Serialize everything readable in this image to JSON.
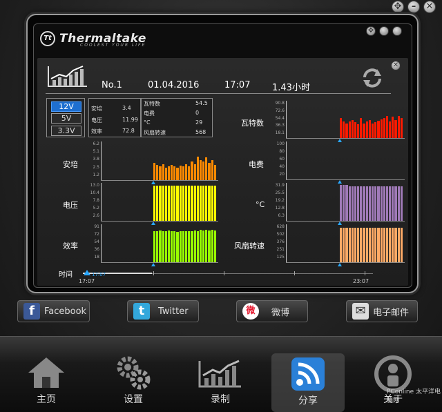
{
  "window": {
    "buttons": [
      "✥",
      "–",
      "✕"
    ]
  },
  "app": {
    "brand": "Thermaltake",
    "tagline": "COOLEST YOUR LIFE",
    "badge": "Tt"
  },
  "header": {
    "device": "No.1",
    "date": "01.04.2016",
    "time": "17:07",
    "duration": "1.43小时"
  },
  "voltage": {
    "options": [
      "12V",
      "5V",
      "3.3V"
    ],
    "selected": "12V"
  },
  "stats": {
    "left": [
      {
        "label": "安培",
        "value": "3.4"
      },
      {
        "label": "电压",
        "value": "11.99"
      },
      {
        "label": "效率",
        "value": "72.8"
      }
    ],
    "right": [
      {
        "label": "瓦特数",
        "value": "54.5"
      },
      {
        "label": "电费",
        "value": "0"
      },
      {
        "label": "°C",
        "value": "29"
      },
      {
        "label": "风扇转速",
        "value": "568"
      }
    ]
  },
  "charts": [
    {
      "name": "安培",
      "color": "#ff8a00",
      "ticks": [
        "6.2",
        "5.1",
        "3.8",
        "2.5",
        "1.2"
      ],
      "min": 0,
      "max": 6.2,
      "values": [
        2.8,
        2.4,
        2.2,
        2.6,
        2.0,
        2.2,
        2.4,
        2.2,
        2.0,
        2.3,
        2.2,
        2.6,
        2.2,
        3.0,
        2.6,
        3.8,
        3.2,
        3.0,
        3.6,
        2.8,
        3.2,
        2.4
      ]
    },
    {
      "name": "电压",
      "color": "#ffff00",
      "ticks": [
        "13.0",
        "10.4",
        "7.8",
        "5.2",
        "2.6"
      ],
      "min": 0,
      "max": 13.0,
      "values": [
        12,
        12,
        12,
        12,
        12,
        12,
        12,
        12,
        12,
        12,
        12,
        12,
        12,
        12,
        12,
        12,
        12,
        12,
        12,
        12,
        12,
        12
      ]
    },
    {
      "name": "效率",
      "color": "#99ff00",
      "ticks": [
        "91",
        "72",
        "54",
        "36",
        "18"
      ],
      "min": 0,
      "max": 91,
      "values": [
        75,
        74,
        76,
        75,
        74,
        76,
        75,
        74,
        73,
        74,
        75,
        74,
        75,
        74,
        76,
        75,
        78,
        76,
        78,
        76,
        78,
        76
      ]
    },
    {
      "name": "瓦特数",
      "color": "#ff1a00",
      "ticks": [
        "90.8",
        "72.6",
        "54.4",
        "36.3",
        "18.1"
      ],
      "min": 0,
      "max": 90.8,
      "values": [
        48,
        40,
        36,
        40,
        44,
        38,
        34,
        48,
        36,
        40,
        44,
        36,
        38,
        42,
        46,
        48,
        54,
        40,
        52,
        44,
        54,
        48
      ]
    },
    {
      "name": "电费",
      "color": "#ff1a00",
      "ticks": [
        "100",
        "80",
        "60",
        "40",
        "20"
      ],
      "min": 0,
      "max": 100,
      "values": []
    },
    {
      "name": "°C",
      "color": "#a07ab8",
      "ticks": [
        "31.9",
        "25.5",
        "19.2",
        "12.8",
        "6.3"
      ],
      "min": 0,
      "max": 31.9,
      "values": [
        30,
        30,
        30,
        29,
        29,
        29,
        29,
        29,
        29,
        29,
        29,
        29,
        29,
        29,
        29,
        29,
        29,
        29,
        29,
        29,
        29,
        29
      ]
    },
    {
      "name": "风扇转速",
      "color": "#ffaa66",
      "ticks": [
        "628",
        "502",
        "376",
        "251",
        "125"
      ],
      "min": 0,
      "max": 628,
      "values": [
        568,
        568,
        568,
        568,
        568,
        568,
        568,
        568,
        568,
        568,
        568,
        568,
        568,
        568,
        568,
        568,
        568,
        568,
        568,
        568,
        568,
        568
      ]
    }
  ],
  "timeline": {
    "label": "时间",
    "start": "17:07",
    "end": "23:07",
    "cursor": "17:07"
  },
  "share": [
    {
      "label": "Facebook",
      "icon": "facebook-icon",
      "glyph": "f"
    },
    {
      "label": "Twitter",
      "icon": "twitter-icon",
      "glyph": "t"
    },
    {
      "label": "微博",
      "icon": "weibo-icon",
      "glyph": "微"
    },
    {
      "label": "电子邮件",
      "icon": "mail-icon",
      "glyph": "✉"
    }
  ],
  "nav": [
    {
      "label": "主页",
      "icon": "home-icon"
    },
    {
      "label": "设置",
      "icon": "gear-icon"
    },
    {
      "label": "录制",
      "icon": "chart-icon"
    },
    {
      "label": "分享",
      "icon": "wifi-share-icon",
      "active": true
    },
    {
      "label": "关于",
      "icon": "about-icon"
    }
  ],
  "watermark": "PConline 太平洋电脑网"
}
